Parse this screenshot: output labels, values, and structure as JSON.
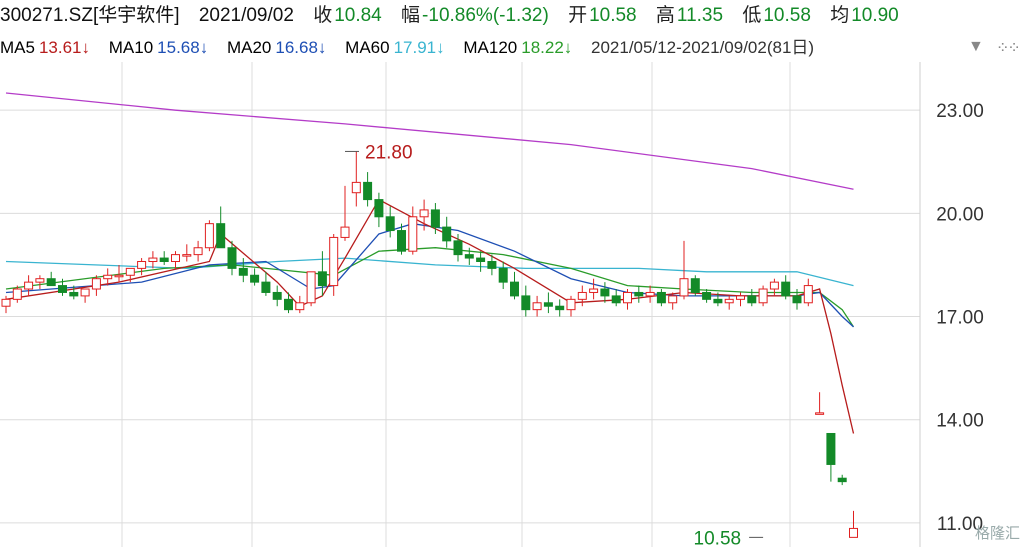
{
  "header": {
    "code_name": "300271.SZ[华宇软件]",
    "date": "2021/09/02",
    "close_label": "收",
    "close": "10.84",
    "amp_label": "幅",
    "amp": "-10.86%(-1.32)",
    "open_label": "开",
    "open": "10.58",
    "high_label": "高",
    "high": "11.35",
    "low_label": "低",
    "low": "10.58",
    "avg_label": "均",
    "avg": "10.90"
  },
  "ma_bar": {
    "ma5": "MA5",
    "ma5_val": "13.61↓",
    "ma10": "MA10",
    "ma10_val": "15.68↓",
    "ma20": "MA20",
    "ma20_val": "16.68↓",
    "ma60": "MA60",
    "ma60_val": "17.91↓",
    "ma120": "MA120",
    "ma120_val": "18.22↓",
    "range": "2021/05/12-2021/09/02(81日)",
    "dropdown_icon": "triangle-down-icon",
    "settings_icon": "grid-dots-icon"
  },
  "watermark": "格隆汇",
  "colors": {
    "up": "#e02020",
    "down": "#138a28",
    "ma5": "#b71c1c",
    "ma10": "#1e4fb4",
    "ma20": "#2a9c2a",
    "ma60": "#39b4d0",
    "ma120": "#b43cc8",
    "grid": "#dcdcdc"
  },
  "chart_data": {
    "type": "candlestick",
    "yticks": [
      "23.00",
      "20.00",
      "17.00",
      "14.00",
      "11.00"
    ],
    "ylim": [
      10.3,
      24.4
    ],
    "annotations": [
      {
        "text": "21.80",
        "index": 30,
        "value": 21.8
      },
      {
        "text": "10.58",
        "index": 67,
        "value": 10.58
      }
    ],
    "candles": [
      [
        17.3,
        17.6,
        17.1,
        17.5
      ],
      [
        17.5,
        17.9,
        17.4,
        17.8
      ],
      [
        17.8,
        18.2,
        17.6,
        18.0
      ],
      [
        18.0,
        18.2,
        17.8,
        18.1
      ],
      [
        18.1,
        18.3,
        17.9,
        17.9
      ],
      [
        17.9,
        18.1,
        17.6,
        17.7
      ],
      [
        17.7,
        17.9,
        17.5,
        17.6
      ],
      [
        17.6,
        17.8,
        17.4,
        17.8
      ],
      [
        17.8,
        18.2,
        17.6,
        18.1
      ],
      [
        18.1,
        18.4,
        17.9,
        18.2
      ],
      [
        18.2,
        18.5,
        18.0,
        18.2
      ],
      [
        18.2,
        18.4,
        18.0,
        18.4
      ],
      [
        18.4,
        18.7,
        18.2,
        18.6
      ],
      [
        18.6,
        18.9,
        18.4,
        18.7
      ],
      [
        18.7,
        18.9,
        18.5,
        18.6
      ],
      [
        18.6,
        18.9,
        18.4,
        18.8
      ],
      [
        18.8,
        19.1,
        18.6,
        18.8
      ],
      [
        18.8,
        19.2,
        18.6,
        19.0
      ],
      [
        19.0,
        19.8,
        18.9,
        19.7
      ],
      [
        19.7,
        20.2,
        19.4,
        19.0
      ],
      [
        19.0,
        19.2,
        18.2,
        18.4
      ],
      [
        18.4,
        18.7,
        18.0,
        18.2
      ],
      [
        18.2,
        18.4,
        17.9,
        18.0
      ],
      [
        18.0,
        18.3,
        17.6,
        17.7
      ],
      [
        17.7,
        17.9,
        17.3,
        17.5
      ],
      [
        17.5,
        17.7,
        17.1,
        17.2
      ],
      [
        17.2,
        17.6,
        17.1,
        17.4
      ],
      [
        17.4,
        18.0,
        17.3,
        18.3
      ],
      [
        18.3,
        18.9,
        17.6,
        17.9
      ],
      [
        17.9,
        19.4,
        17.6,
        19.3
      ],
      [
        19.3,
        20.8,
        19.2,
        19.6
      ],
      [
        20.6,
        21.8,
        20.2,
        20.9
      ],
      [
        20.9,
        21.2,
        20.2,
        20.4
      ],
      [
        20.4,
        20.6,
        19.6,
        19.9
      ],
      [
        19.9,
        20.2,
        19.3,
        19.5
      ],
      [
        19.5,
        19.7,
        18.8,
        18.9
      ],
      [
        18.9,
        20.2,
        18.8,
        19.9
      ],
      [
        19.9,
        20.4,
        19.5,
        20.1
      ],
      [
        20.1,
        20.3,
        19.4,
        19.6
      ],
      [
        19.6,
        19.9,
        19.0,
        19.2
      ],
      [
        19.2,
        19.4,
        18.6,
        18.8
      ],
      [
        18.8,
        19.0,
        18.5,
        18.7
      ],
      [
        18.7,
        18.9,
        18.3,
        18.6
      ],
      [
        18.6,
        18.8,
        18.2,
        18.4
      ],
      [
        18.4,
        18.6,
        17.8,
        18.0
      ],
      [
        18.0,
        18.3,
        17.5,
        17.6
      ],
      [
        17.6,
        17.9,
        17.0,
        17.2
      ],
      [
        17.2,
        17.6,
        17.0,
        17.4
      ],
      [
        17.4,
        17.7,
        17.1,
        17.3
      ],
      [
        17.3,
        17.5,
        17.0,
        17.2
      ],
      [
        17.2,
        17.6,
        17.0,
        17.5
      ],
      [
        17.5,
        17.9,
        17.3,
        17.7
      ],
      [
        17.7,
        18.1,
        17.5,
        17.8
      ],
      [
        17.8,
        18.0,
        17.4,
        17.6
      ],
      [
        17.6,
        17.8,
        17.3,
        17.4
      ],
      [
        17.4,
        17.8,
        17.2,
        17.7
      ],
      [
        17.7,
        17.9,
        17.4,
        17.6
      ],
      [
        17.6,
        17.9,
        17.4,
        17.7
      ],
      [
        17.7,
        17.8,
        17.3,
        17.4
      ],
      [
        17.4,
        17.7,
        17.2,
        17.6
      ],
      [
        17.6,
        19.2,
        17.5,
        18.1
      ],
      [
        18.1,
        18.2,
        17.6,
        17.7
      ],
      [
        17.7,
        17.8,
        17.4,
        17.5
      ],
      [
        17.5,
        17.7,
        17.3,
        17.4
      ],
      [
        17.4,
        17.6,
        17.2,
        17.5
      ],
      [
        17.5,
        17.7,
        17.3,
        17.6
      ],
      [
        17.6,
        17.8,
        17.3,
        17.4
      ],
      [
        17.4,
        17.9,
        17.3,
        17.8
      ],
      [
        17.8,
        18.1,
        17.6,
        18.0
      ],
      [
        18.0,
        18.2,
        17.5,
        17.6
      ],
      [
        17.6,
        17.8,
        17.2,
        17.4
      ],
      [
        17.4,
        18.1,
        17.3,
        17.9
      ],
      [
        14.2,
        14.8,
        14.2,
        14.2
      ],
      [
        13.6,
        13.6,
        12.2,
        12.7
      ],
      [
        12.3,
        12.4,
        12.1,
        12.2
      ],
      [
        10.58,
        11.35,
        10.58,
        10.84
      ]
    ],
    "ma5": [
      [
        0,
        17.5
      ],
      [
        10,
        18.0
      ],
      [
        18,
        18.6
      ],
      [
        19,
        19.4
      ],
      [
        24,
        18.0
      ],
      [
        26,
        17.3
      ],
      [
        28,
        17.6
      ],
      [
        30,
        18.7
      ],
      [
        33,
        20.4
      ],
      [
        37,
        19.7
      ],
      [
        41,
        19.1
      ],
      [
        45,
        18.4
      ],
      [
        50,
        17.4
      ],
      [
        55,
        17.5
      ],
      [
        60,
        17.7
      ],
      [
        65,
        17.6
      ],
      [
        70,
        17.6
      ],
      [
        72,
        17.8
      ],
      [
        73,
        16.5
      ],
      [
        74,
        15.0
      ],
      [
        75,
        13.6
      ]
    ],
    "ma10": [
      [
        0,
        17.7
      ],
      [
        12,
        18.0
      ],
      [
        18,
        18.5
      ],
      [
        23,
        18.6
      ],
      [
        27,
        17.8
      ],
      [
        29,
        17.9
      ],
      [
        33,
        19.4
      ],
      [
        36,
        19.7
      ],
      [
        40,
        19.5
      ],
      [
        45,
        18.9
      ],
      [
        50,
        18.1
      ],
      [
        55,
        17.7
      ],
      [
        60,
        17.6
      ],
      [
        66,
        17.6
      ],
      [
        70,
        17.6
      ],
      [
        72,
        17.7
      ],
      [
        74,
        17.0
      ],
      [
        75,
        16.7
      ]
    ],
    "ma20": [
      [
        0,
        17.8
      ],
      [
        14,
        18.4
      ],
      [
        20,
        18.5
      ],
      [
        29,
        18.2
      ],
      [
        33,
        18.9
      ],
      [
        38,
        19.0
      ],
      [
        44,
        18.8
      ],
      [
        50,
        18.4
      ],
      [
        55,
        17.9
      ],
      [
        60,
        17.8
      ],
      [
        66,
        17.7
      ],
      [
        72,
        17.7
      ],
      [
        74,
        17.2
      ],
      [
        75,
        16.7
      ]
    ],
    "ma60": [
      [
        0,
        18.6
      ],
      [
        16,
        18.4
      ],
      [
        24,
        18.6
      ],
      [
        30,
        18.7
      ],
      [
        38,
        18.5
      ],
      [
        46,
        18.4
      ],
      [
        56,
        18.4
      ],
      [
        62,
        18.3
      ],
      [
        70,
        18.3
      ],
      [
        75,
        17.9
      ]
    ],
    "ma120": [
      [
        0,
        23.5
      ],
      [
        15,
        23.0
      ],
      [
        30,
        22.6
      ],
      [
        50,
        22.0
      ],
      [
        66,
        21.3
      ],
      [
        75,
        20.7
      ]
    ]
  }
}
